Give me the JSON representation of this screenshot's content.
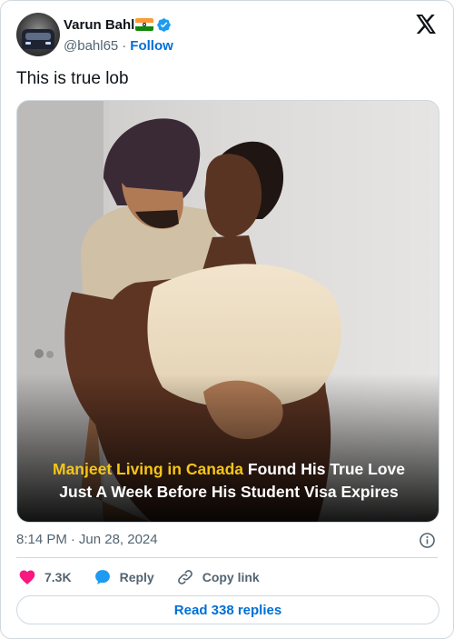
{
  "author": {
    "display_name": "Varun Bahl",
    "flag_icon": "india-flag-icon",
    "verified_icon": "verified-badge-icon",
    "handle": "@bahl65",
    "separator": "·",
    "follow_label": "Follow"
  },
  "platform_icon": "x-logo-icon",
  "tweet": {
    "text": "This is true lob"
  },
  "media": {
    "caption_highlight": "Manjeet Living in Canada",
    "caption_line1_rest": " Found His True Love",
    "caption_line2": "Just A Week Before His Student Visa Expires"
  },
  "meta": {
    "time": "8:14 PM",
    "separator": "·",
    "date": "Jun 28, 2024",
    "info_icon": "info-icon"
  },
  "actions": {
    "likes": "7.3K",
    "reply_label": "Reply",
    "copy_label": "Copy link"
  },
  "read_replies_label": "Read 338 replies",
  "colors": {
    "accent": "#006fd6",
    "heart": "#f91880",
    "reply": "#1d9bf0",
    "secondary_text": "#536471",
    "border": "#cfd9de",
    "caption_yellow": "#f5c518"
  }
}
